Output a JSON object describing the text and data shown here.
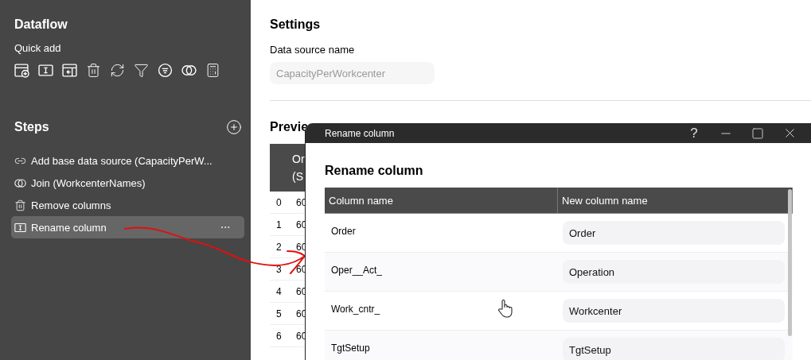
{
  "sidebar": {
    "title": "Dataflow",
    "quick_add_label": "Quick add",
    "steps_title": "Steps",
    "steps": [
      {
        "label": "Add base data source (CapacityPerW...",
        "kind": "source",
        "selected": false
      },
      {
        "label": "Join (WorkcenterNames)",
        "kind": "join",
        "selected": false
      },
      {
        "label": "Remove columns",
        "kind": "remove",
        "selected": false
      },
      {
        "label": "Rename column",
        "kind": "rename",
        "selected": true
      }
    ]
  },
  "settings": {
    "title": "Settings",
    "field_label": "Data source name",
    "placeholder": "CapacityPerWorkcenter"
  },
  "preview": {
    "title": "Previe",
    "column_1": "Or (S",
    "rows": [
      {
        "index": "0",
        "cell": "60"
      },
      {
        "index": "1",
        "cell": "60"
      },
      {
        "index": "2",
        "cell": "60"
      },
      {
        "index": "3",
        "cell": "60"
      },
      {
        "index": "4",
        "cell": "60"
      },
      {
        "index": "5",
        "cell": "60"
      },
      {
        "index": "6",
        "cell": "60"
      }
    ]
  },
  "dialog": {
    "title": "Rename column",
    "help": "?",
    "heading": "Rename column",
    "columns": [
      "Column name",
      "New column name"
    ],
    "rows": [
      {
        "column_name": "Order",
        "new_name": "Order"
      },
      {
        "column_name": "Oper__Act_",
        "new_name": "Operation"
      },
      {
        "column_name": "Work_cntr_",
        "new_name": "Workcenter"
      },
      {
        "column_name": "TgtSetup",
        "new_name": "TgtSetup"
      }
    ]
  }
}
